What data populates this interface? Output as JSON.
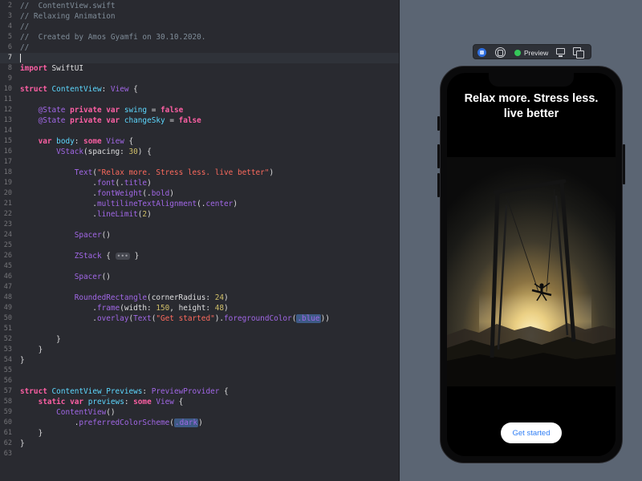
{
  "editor": {
    "lines": [
      {
        "n": "2",
        "tokens": [
          {
            "t": "comment",
            "v": "//  ContentView.swift"
          }
        ]
      },
      {
        "n": "3",
        "tokens": [
          {
            "t": "comment",
            "v": "// Relaxing Animation"
          }
        ]
      },
      {
        "n": "4",
        "tokens": [
          {
            "t": "comment",
            "v": "//"
          }
        ]
      },
      {
        "n": "5",
        "tokens": [
          {
            "t": "comment",
            "v": "//  Created by Amos Gyamfi on 30.10.2020."
          }
        ]
      },
      {
        "n": "6",
        "tokens": [
          {
            "t": "comment",
            "v": "//"
          }
        ]
      },
      {
        "n": "7",
        "current": true,
        "tokens": [
          {
            "t": "cursor",
            "v": ""
          }
        ]
      },
      {
        "n": "8",
        "tokens": [
          {
            "t": "keyword",
            "v": "import"
          },
          {
            "t": "plain",
            "v": " SwiftUI"
          }
        ]
      },
      {
        "n": "9",
        "tokens": []
      },
      {
        "n": "10",
        "tokens": [
          {
            "t": "keyword",
            "v": "struct"
          },
          {
            "t": "plain",
            "v": " "
          },
          {
            "t": "type",
            "v": "ContentView"
          },
          {
            "t": "plain",
            "v": ": "
          },
          {
            "t": "func",
            "v": "View"
          },
          {
            "t": "plain",
            "v": " {"
          }
        ]
      },
      {
        "n": "11",
        "tokens": []
      },
      {
        "n": "12",
        "tokens": [
          {
            "t": "plain",
            "v": "    "
          },
          {
            "t": "func",
            "v": "@State"
          },
          {
            "t": "plain",
            "v": " "
          },
          {
            "t": "keyword",
            "v": "private var"
          },
          {
            "t": "plain",
            "v": " "
          },
          {
            "t": "type",
            "v": "swing"
          },
          {
            "t": "plain",
            "v": " = "
          },
          {
            "t": "keyword",
            "v": "false"
          }
        ]
      },
      {
        "n": "13",
        "tokens": [
          {
            "t": "plain",
            "v": "    "
          },
          {
            "t": "func",
            "v": "@State"
          },
          {
            "t": "plain",
            "v": " "
          },
          {
            "t": "keyword",
            "v": "private var"
          },
          {
            "t": "plain",
            "v": " "
          },
          {
            "t": "type",
            "v": "changeSky"
          },
          {
            "t": "plain",
            "v": " = "
          },
          {
            "t": "keyword",
            "v": "false"
          }
        ]
      },
      {
        "n": "14",
        "tokens": []
      },
      {
        "n": "15",
        "tokens": [
          {
            "t": "plain",
            "v": "    "
          },
          {
            "t": "keyword",
            "v": "var"
          },
          {
            "t": "plain",
            "v": " "
          },
          {
            "t": "type",
            "v": "body"
          },
          {
            "t": "plain",
            "v": ": "
          },
          {
            "t": "keyword",
            "v": "some"
          },
          {
            "t": "plain",
            "v": " "
          },
          {
            "t": "func",
            "v": "View"
          },
          {
            "t": "plain",
            "v": " {"
          }
        ]
      },
      {
        "n": "16",
        "tokens": [
          {
            "t": "plain",
            "v": "        "
          },
          {
            "t": "func",
            "v": "VStack"
          },
          {
            "t": "plain",
            "v": "(spacing: "
          },
          {
            "t": "number",
            "v": "30"
          },
          {
            "t": "plain",
            "v": ") {"
          }
        ]
      },
      {
        "n": "17",
        "tokens": []
      },
      {
        "n": "18",
        "tokens": [
          {
            "t": "plain",
            "v": "            "
          },
          {
            "t": "func",
            "v": "Text"
          },
          {
            "t": "plain",
            "v": "("
          },
          {
            "t": "string",
            "v": "\"Relax more. Stress less. live better\""
          },
          {
            "t": "plain",
            "v": ")"
          }
        ]
      },
      {
        "n": "19",
        "tokens": [
          {
            "t": "plain",
            "v": "                ."
          },
          {
            "t": "func",
            "v": "font"
          },
          {
            "t": "plain",
            "v": "(."
          },
          {
            "t": "func",
            "v": "title"
          },
          {
            "t": "plain",
            "v": ")"
          }
        ]
      },
      {
        "n": "20",
        "tokens": [
          {
            "t": "plain",
            "v": "                ."
          },
          {
            "t": "func",
            "v": "fontWeight"
          },
          {
            "t": "plain",
            "v": "(."
          },
          {
            "t": "func",
            "v": "bold"
          },
          {
            "t": "plain",
            "v": ")"
          }
        ]
      },
      {
        "n": "21",
        "tokens": [
          {
            "t": "plain",
            "v": "                ."
          },
          {
            "t": "func",
            "v": "multilineTextAlignment"
          },
          {
            "t": "plain",
            "v": "(."
          },
          {
            "t": "func",
            "v": "center"
          },
          {
            "t": "plain",
            "v": ")"
          }
        ]
      },
      {
        "n": "22",
        "tokens": [
          {
            "t": "plain",
            "v": "                ."
          },
          {
            "t": "func",
            "v": "lineLimit"
          },
          {
            "t": "plain",
            "v": "("
          },
          {
            "t": "number",
            "v": "2"
          },
          {
            "t": "plain",
            "v": ")"
          }
        ]
      },
      {
        "n": "23",
        "tokens": []
      },
      {
        "n": "24",
        "tokens": [
          {
            "t": "plain",
            "v": "            "
          },
          {
            "t": "func",
            "v": "Spacer"
          },
          {
            "t": "plain",
            "v": "()"
          }
        ]
      },
      {
        "n": "25",
        "tokens": []
      },
      {
        "n": "26",
        "tokens": [
          {
            "t": "plain",
            "v": "            "
          },
          {
            "t": "func",
            "v": "ZStack"
          },
          {
            "t": "plain",
            "v": " { "
          },
          {
            "t": "fold",
            "v": "•••"
          },
          {
            "t": "plain",
            "v": " }"
          }
        ]
      },
      {
        "n": "45",
        "tokens": []
      },
      {
        "n": "46",
        "tokens": [
          {
            "t": "plain",
            "v": "            "
          },
          {
            "t": "func",
            "v": "Spacer"
          },
          {
            "t": "plain",
            "v": "()"
          }
        ]
      },
      {
        "n": "47",
        "tokens": []
      },
      {
        "n": "48",
        "tokens": [
          {
            "t": "plain",
            "v": "            "
          },
          {
            "t": "func",
            "v": "RoundedRectangle"
          },
          {
            "t": "plain",
            "v": "(cornerRadius: "
          },
          {
            "t": "number",
            "v": "24"
          },
          {
            "t": "plain",
            "v": ")"
          }
        ]
      },
      {
        "n": "49",
        "tokens": [
          {
            "t": "plain",
            "v": "                ."
          },
          {
            "t": "func",
            "v": "frame"
          },
          {
            "t": "plain",
            "v": "(width: "
          },
          {
            "t": "number",
            "v": "150"
          },
          {
            "t": "plain",
            "v": ", height: "
          },
          {
            "t": "number",
            "v": "48"
          },
          {
            "t": "plain",
            "v": ")"
          }
        ]
      },
      {
        "n": "50",
        "tokens": [
          {
            "t": "plain",
            "v": "                ."
          },
          {
            "t": "func",
            "v": "overlay"
          },
          {
            "t": "plain",
            "v": "("
          },
          {
            "t": "func",
            "v": "Text"
          },
          {
            "t": "plain",
            "v": "("
          },
          {
            "t": "string",
            "v": "\"Get started\""
          },
          {
            "t": "plain",
            "v": ")."
          },
          {
            "t": "func",
            "v": "foregroundColor"
          },
          {
            "t": "plain",
            "v": "("
          },
          {
            "t": "hl",
            "v": ".blue"
          },
          {
            "t": "plain",
            "v": "))"
          }
        ]
      },
      {
        "n": "51",
        "tokens": []
      },
      {
        "n": "52",
        "tokens": [
          {
            "t": "plain",
            "v": "        }"
          }
        ]
      },
      {
        "n": "53",
        "tokens": [
          {
            "t": "plain",
            "v": "    }"
          }
        ]
      },
      {
        "n": "54",
        "tokens": [
          {
            "t": "plain",
            "v": "}"
          }
        ]
      },
      {
        "n": "55",
        "tokens": []
      },
      {
        "n": "56",
        "tokens": []
      },
      {
        "n": "57",
        "tokens": [
          {
            "t": "keyword",
            "v": "struct"
          },
          {
            "t": "plain",
            "v": " "
          },
          {
            "t": "type",
            "v": "ContentView_Previews"
          },
          {
            "t": "plain",
            "v": ": "
          },
          {
            "t": "func",
            "v": "PreviewProvider"
          },
          {
            "t": "plain",
            "v": " {"
          }
        ]
      },
      {
        "n": "58",
        "tokens": [
          {
            "t": "plain",
            "v": "    "
          },
          {
            "t": "keyword",
            "v": "static var"
          },
          {
            "t": "plain",
            "v": " "
          },
          {
            "t": "type",
            "v": "previews"
          },
          {
            "t": "plain",
            "v": ": "
          },
          {
            "t": "keyword",
            "v": "some"
          },
          {
            "t": "plain",
            "v": " "
          },
          {
            "t": "func",
            "v": "View"
          },
          {
            "t": "plain",
            "v": " {"
          }
        ]
      },
      {
        "n": "59",
        "tokens": [
          {
            "t": "plain",
            "v": "        "
          },
          {
            "t": "func",
            "v": "ContentView"
          },
          {
            "t": "plain",
            "v": "()"
          }
        ]
      },
      {
        "n": "60",
        "tokens": [
          {
            "t": "plain",
            "v": "            ."
          },
          {
            "t": "func",
            "v": "preferredColorScheme"
          },
          {
            "t": "plain",
            "v": "("
          },
          {
            "t": "hl",
            "v": ".dark"
          },
          {
            "t": "plain",
            "v": ")"
          }
        ]
      },
      {
        "n": "61",
        "tokens": [
          {
            "t": "plain",
            "v": "    }"
          }
        ]
      },
      {
        "n": "62",
        "tokens": [
          {
            "t": "plain",
            "v": "}"
          }
        ]
      },
      {
        "n": "63",
        "tokens": []
      }
    ]
  },
  "preview_toolbar": {
    "live_icon": "live-preview-icon",
    "inspect_icon": "inspect-preview-icon",
    "preview_label": "Preview",
    "status_color": "#35c759",
    "device_icon": "device-settings-icon",
    "duplicate_icon": "duplicate-preview-icon"
  },
  "phone_preview": {
    "headline": "Relax more. Stress less. live better",
    "image_subject": "person-on-swing-at-sunset",
    "button_label": "Get started",
    "button_text_color": "#2f7ef5"
  }
}
